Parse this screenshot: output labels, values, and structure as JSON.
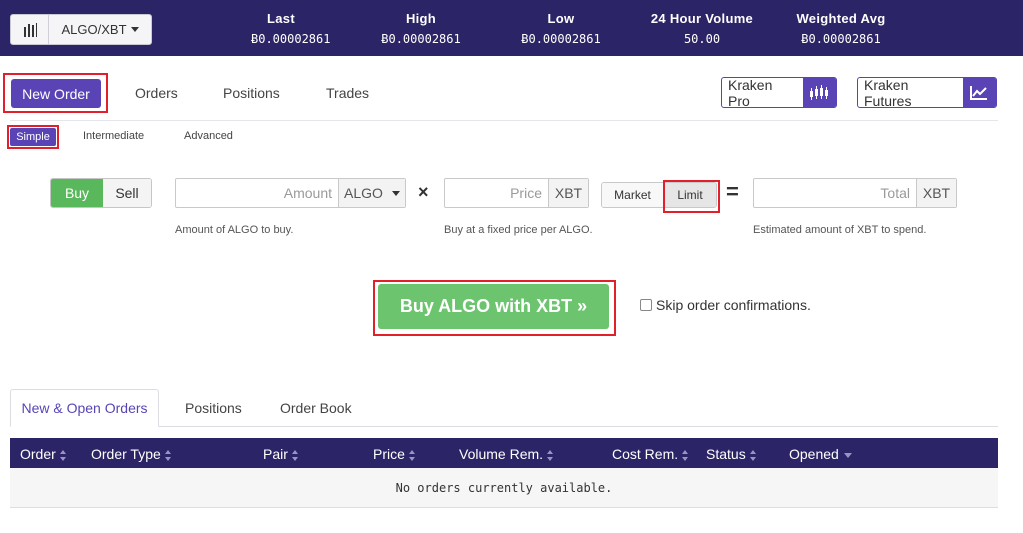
{
  "header": {
    "pair_label": "ALGO/XBT",
    "stats": [
      {
        "label": "Last",
        "value": "Ƀ0.00002861"
      },
      {
        "label": "High",
        "value": "Ƀ0.00002861"
      },
      {
        "label": "Low",
        "value": "Ƀ0.00002861"
      },
      {
        "label": "24 Hour Volume",
        "value": "50.00"
      },
      {
        "label": "Weighted Avg",
        "value": "Ƀ0.00002861"
      }
    ]
  },
  "main_tabs": {
    "new_order": "New Order",
    "orders": "Orders",
    "positions": "Positions",
    "trades": "Trades"
  },
  "links": {
    "kraken_pro": "Kraken Pro",
    "kraken_futures": "Kraken Futures"
  },
  "sub_tabs": {
    "simple": "Simple",
    "intermediate": "Intermediate",
    "advanced": "Advanced"
  },
  "form": {
    "buy_label": "Buy",
    "sell_label": "Sell",
    "amount_placeholder": "Amount",
    "amount_unit": "ALGO",
    "amount_hint": "Amount of ALGO to buy.",
    "times_sign": "×",
    "price_placeholder": "Price",
    "price_unit": "XBT",
    "price_hint": "Buy at a fixed price per ALGO.",
    "market_label": "Market",
    "limit_label": "Limit",
    "equals_sign": "=",
    "total_placeholder": "Total",
    "total_unit": "XBT",
    "total_hint": "Estimated amount of XBT to spend.",
    "submit_label": "Buy ALGO with XBT »",
    "skip_label": "Skip order confirmations.",
    "skip_checked": false
  },
  "bottom_tabs": {
    "new_open_orders": "New & Open Orders",
    "positions": "Positions",
    "order_book": "Order Book"
  },
  "table": {
    "columns": [
      "Order",
      "Order Type",
      "Pair",
      "Price",
      "Volume Rem.",
      "Cost Rem.",
      "Status",
      "Opened"
    ],
    "empty_message": "No orders currently available."
  },
  "colors": {
    "header_bg": "#2b2466",
    "accent": "#5a44b5",
    "buy_green": "#59b85c",
    "highlight_red": "#e0202a"
  }
}
